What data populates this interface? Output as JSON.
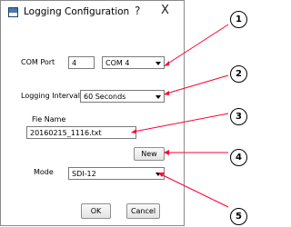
{
  "dialog": {
    "title": "Logging Configuration",
    "help": "?",
    "close": "X"
  },
  "form": {
    "com_port_label": "COM Port",
    "com_port_value": "4",
    "com_port_select": "COM 4",
    "logging_interval_label": "Logging Interval",
    "logging_interval_value": "60 Seconds",
    "file_name_label": "Fie Name",
    "file_name_value": "20160215_1116.txt",
    "new_button": "New",
    "mode_label": "Mode",
    "mode_value": "SDI-12",
    "ok_button": "OK",
    "cancel_button": "Cancel"
  },
  "callouts": [
    "1",
    "2",
    "3",
    "4",
    "5"
  ],
  "colors": {
    "callout_arrow": "#ff0033"
  }
}
